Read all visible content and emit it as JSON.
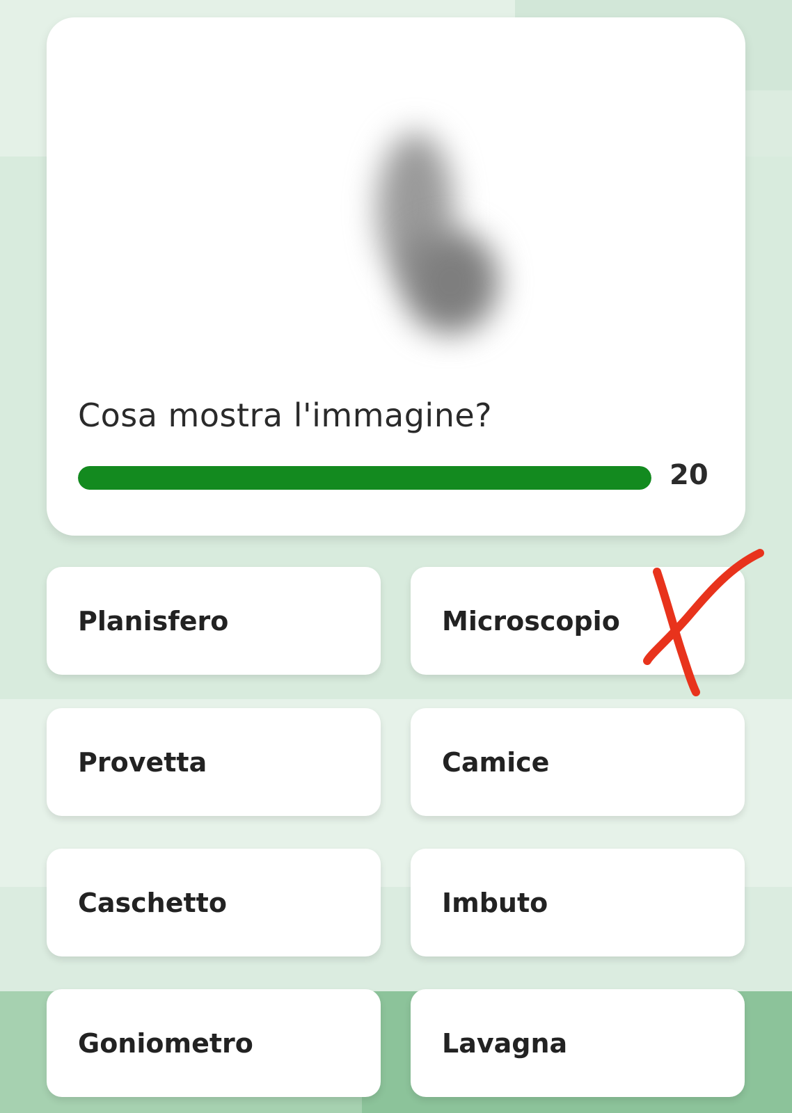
{
  "quiz": {
    "question": "Cosa mostra l'immagine?",
    "timer_value": "20",
    "timer_progress": 1.0,
    "progress_color": "#138a1f",
    "image_icon": "blurred-image-placeholder"
  },
  "answers": [
    {
      "label": "Planisfero"
    },
    {
      "label": "Microscopio"
    },
    {
      "label": "Provetta"
    },
    {
      "label": "Camice"
    },
    {
      "label": "Caschetto"
    },
    {
      "label": "Imbuto"
    },
    {
      "label": "Goniometro"
    },
    {
      "label": "Lavagna"
    }
  ],
  "annotation": {
    "icon": "hand-drawn-x-mark-icon",
    "color": "#e8331c"
  }
}
